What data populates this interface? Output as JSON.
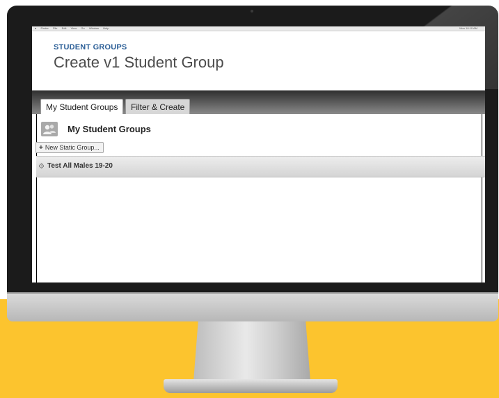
{
  "menubar": {
    "apple": "●",
    "items": [
      "Finder",
      "File",
      "Edit",
      "View",
      "Go",
      "Window",
      "Help"
    ],
    "status": "Mon 10:10 AM"
  },
  "header": {
    "overline": "STUDENT GROUPS",
    "title": "Create v1 Student Group"
  },
  "tabs": [
    {
      "label": "My Student Groups",
      "active": true
    },
    {
      "label": "Filter & Create",
      "active": false
    }
  ],
  "section": {
    "icon": "people-icon",
    "title": "My Student Groups"
  },
  "new_button": {
    "icon": "plus-icon",
    "label": "New Static Group..."
  },
  "groups": [
    {
      "icon": "gear-icon",
      "name": "Test All Males 19-20"
    }
  ],
  "colors": {
    "accent_blue": "#2c5f97",
    "backdrop_yellow": "#fcc42e",
    "bezel": "#1b1b1b"
  }
}
